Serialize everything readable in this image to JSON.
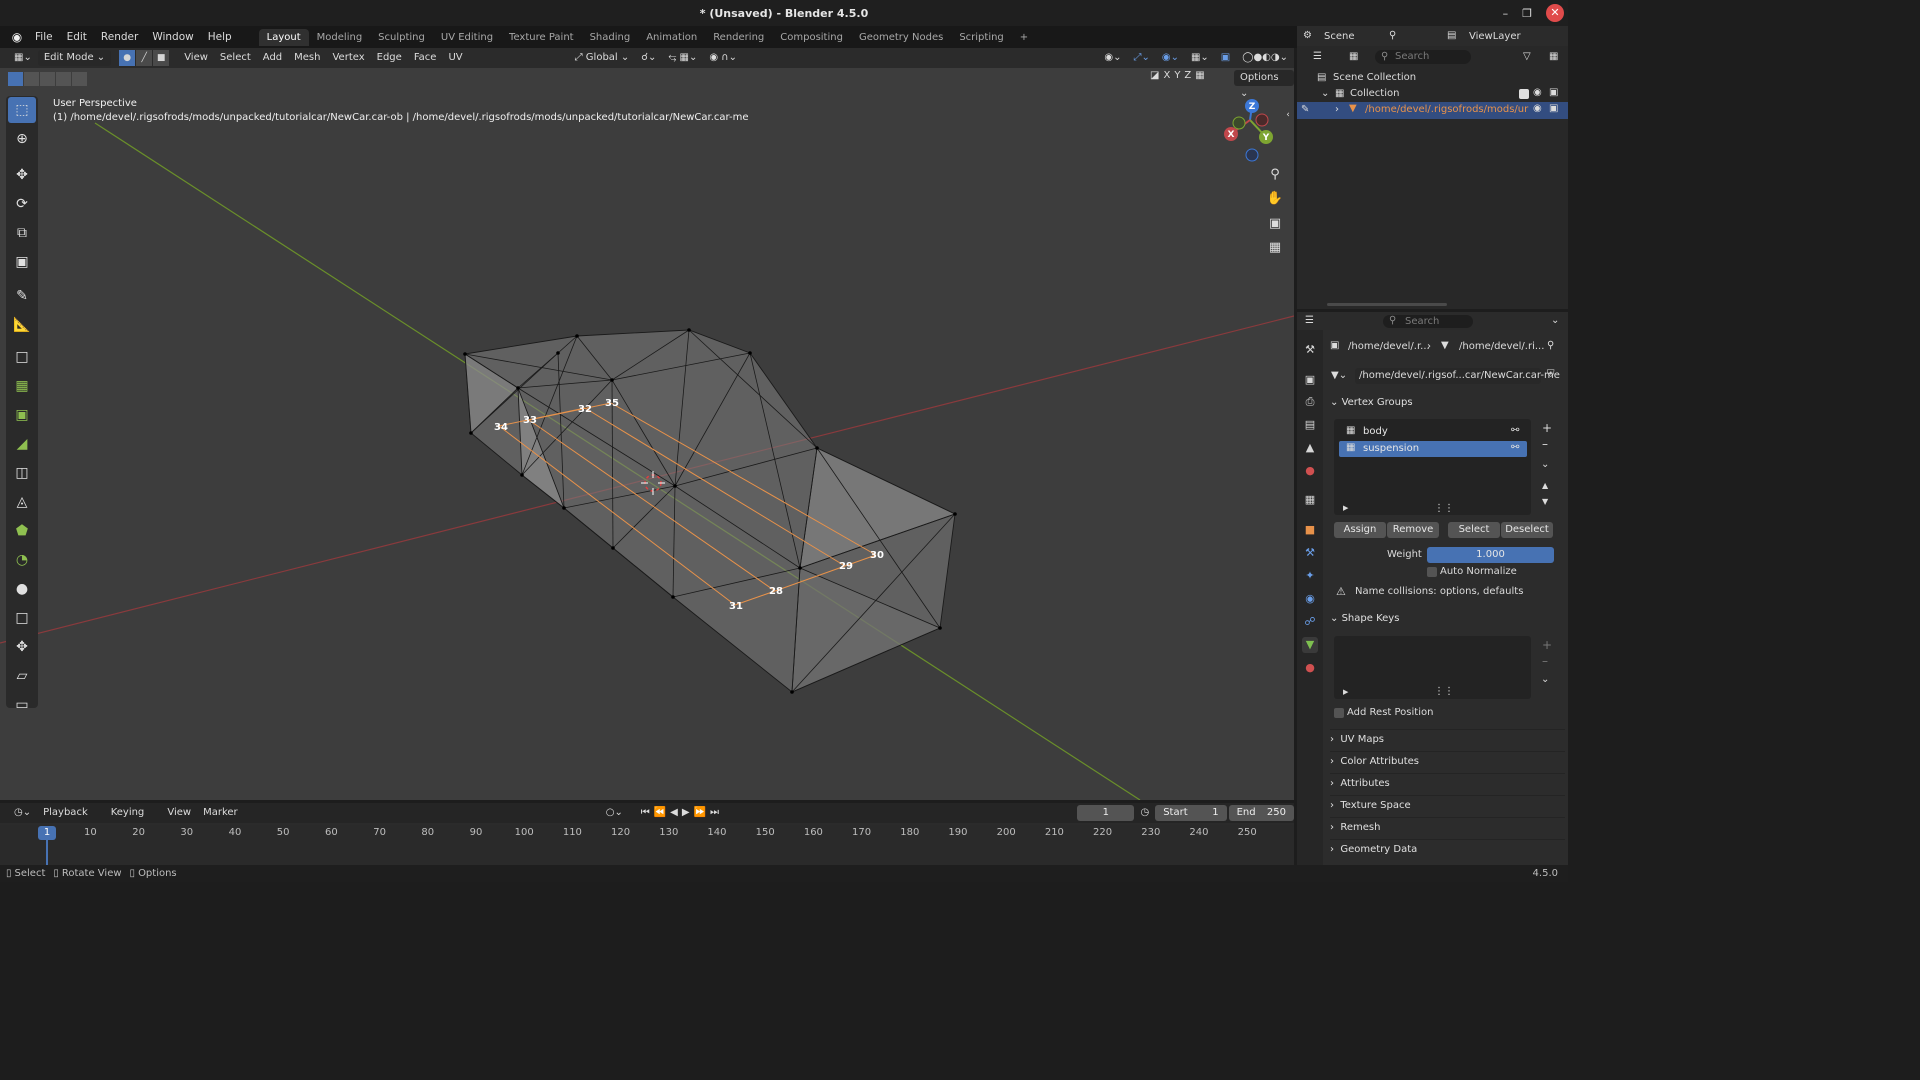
{
  "title_bar": {
    "title": "* (Unsaved) - Blender 4.5.0"
  },
  "menus": [
    "File",
    "Edit",
    "Render",
    "Window",
    "Help"
  ],
  "workspaces": [
    "Layout",
    "Modeling",
    "Sculpting",
    "UV Editing",
    "Texture Paint",
    "Shading",
    "Animation",
    "Rendering",
    "Compositing",
    "Geometry Nodes",
    "Scripting"
  ],
  "workspace_active": "Layout",
  "scene": {
    "label": "Scene",
    "view_layer": "ViewLayer"
  },
  "viewport": {
    "mode": "Edit Mode",
    "menus": [
      "View",
      "Select",
      "Add",
      "Mesh",
      "Vertex",
      "Edge",
      "Face",
      "UV"
    ],
    "orientation": "Global",
    "options_label": "Options",
    "perspective": "User Perspective",
    "object_path": "(1) /home/devel/.rigsofrods/mods/unpacked/tutorialcar/NewCar.car-ob | /home/devel/.rigsofrods/mods/unpacked/tutorialcar/NewCar.car-me",
    "vertex_labels": [
      "34",
      "33",
      "32",
      "35",
      "30",
      "29",
      "28",
      "31"
    ],
    "gizmo_axes": [
      "X",
      "Y",
      "Z"
    ],
    "xyz_toggles": [
      "X",
      "Y",
      "Z"
    ]
  },
  "timeline": {
    "menus": [
      "Playback",
      "Keying",
      "View",
      "Marker"
    ],
    "current_frame": "1",
    "start_label": "Start",
    "start": "1",
    "end_label": "End",
    "end": "250",
    "ticks": [
      "1",
      "10",
      "20",
      "30",
      "40",
      "50",
      "60",
      "70",
      "80",
      "90",
      "100",
      "110",
      "120",
      "130",
      "140",
      "150",
      "160",
      "170",
      "180",
      "190",
      "200",
      "210",
      "220",
      "230",
      "240",
      "250"
    ]
  },
  "statusbar": {
    "items": [
      "Select",
      "Rotate View",
      "Options"
    ],
    "version": "4.5.0"
  },
  "outliner": {
    "search_placeholder": "Search",
    "scene_collection": "Scene Collection",
    "collection": "Collection",
    "object": "/home/devel/.rigsofrods/mods/ur"
  },
  "properties": {
    "search_placeholder": "Search",
    "breadcrumb_object": "/home/devel/.r...",
    "breadcrumb_mesh": "/home/devel/.ri...",
    "datablock": "/home/devel/.rigsof...car/NewCar.car-me",
    "vertex_groups_header": "Vertex Groups",
    "vertex_groups": [
      "body",
      "suspension"
    ],
    "selected_group": "suspension",
    "buttons": {
      "assign": "Assign",
      "remove": "Remove",
      "select": "Select",
      "deselect": "Deselect"
    },
    "weight_label": "Weight",
    "weight": "1.000",
    "auto_normalize": "Auto Normalize",
    "warning": "Name collisions: options, defaults",
    "shape_keys_header": "Shape Keys",
    "add_rest_position": "Add Rest Position",
    "collapsed_panels": [
      "UV Maps",
      "Color Attributes",
      "Attributes",
      "Texture Space",
      "Remesh",
      "Geometry Data"
    ]
  },
  "colors": {
    "accent": "#4772b3",
    "x_axis": "#c0474b",
    "y_axis": "#7ea531",
    "z_axis": "#3c78d8",
    "selected_edge": "#e8924a"
  }
}
